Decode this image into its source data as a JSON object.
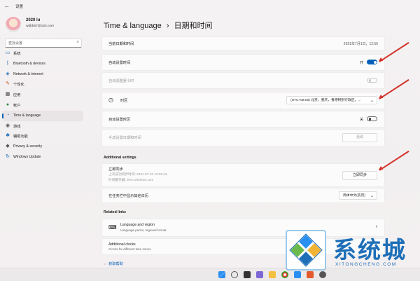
{
  "window": {
    "title": "设置"
  },
  "user": {
    "name": "2020 lu",
    "email": "wdbb67@163.com"
  },
  "search": {
    "placeholder": "查找设置"
  },
  "sidebar": {
    "items": [
      {
        "label": "系统",
        "icon": "monitor-icon",
        "color": "#1e6fb8"
      },
      {
        "label": "Bluetooth & devices",
        "icon": "bluetooth-icon",
        "color": "#1e6fb8"
      },
      {
        "label": "Network & internet",
        "icon": "wifi-icon",
        "color": "#1e6fb8"
      },
      {
        "label": "个性化",
        "icon": "brush-icon",
        "color": "#c2560f"
      },
      {
        "label": "应用",
        "icon": "apps-icon",
        "color": "#444"
      },
      {
        "label": "帐户",
        "icon": "person-icon",
        "color": "#2a8a3e"
      },
      {
        "label": "Time & language",
        "icon": "globe-clock-icon",
        "color": "#1e6fb8",
        "active": true
      },
      {
        "label": "游戏",
        "icon": "gamepad-icon",
        "color": "#555"
      },
      {
        "label": "辅助功能",
        "icon": "accessibility-icon",
        "color": "#1e6fb8"
      },
      {
        "label": "Privacy & security",
        "icon": "shield-icon",
        "color": "#555"
      },
      {
        "label": "Windows Update",
        "icon": "update-icon",
        "color": "#1e6fb8"
      }
    ]
  },
  "page": {
    "breadcrumb_parent": "Time & language",
    "breadcrumb_sep": "›",
    "title": "日期和时间"
  },
  "rows": {
    "current_datetime": {
      "label": "当前日期和时间",
      "value": "2021年7月1日，12:56"
    },
    "auto_time": {
      "label": "自动设置时间",
      "state": "开"
    },
    "auto_dst": {
      "label": "自动调整夏令时"
    },
    "timezone": {
      "label": "时区",
      "value": "(UTC+08:00) 北京，重庆，香港特别行政区，..."
    },
    "auto_timezone": {
      "label": "自动设置时区",
      "state": "关"
    },
    "manual": {
      "label": "手动设置日期和时间",
      "button": "更改"
    }
  },
  "additional": {
    "heading": "Additional settings",
    "sync": {
      "label": "立即同步",
      "last": "上次成功同步时间: 2021-07-01 10:02:43",
      "server": "时间服务器: time.windows.com",
      "button": "立即同步"
    },
    "taskbar_cal": {
      "label": "在任务栏中显示其他日历",
      "value": "简体中文(农历)"
    }
  },
  "related": {
    "heading": "Related links",
    "lang_region": {
      "title": "Language and region",
      "sub": "Language packs, regional format"
    },
    "clocks": {
      "title": "Additional clocks",
      "sub": "Clocks for different time zones"
    }
  },
  "help": {
    "label": "获取帮助"
  },
  "watermark": {
    "cn": "系统城",
    "en": "XITONGCHENG.COM"
  }
}
